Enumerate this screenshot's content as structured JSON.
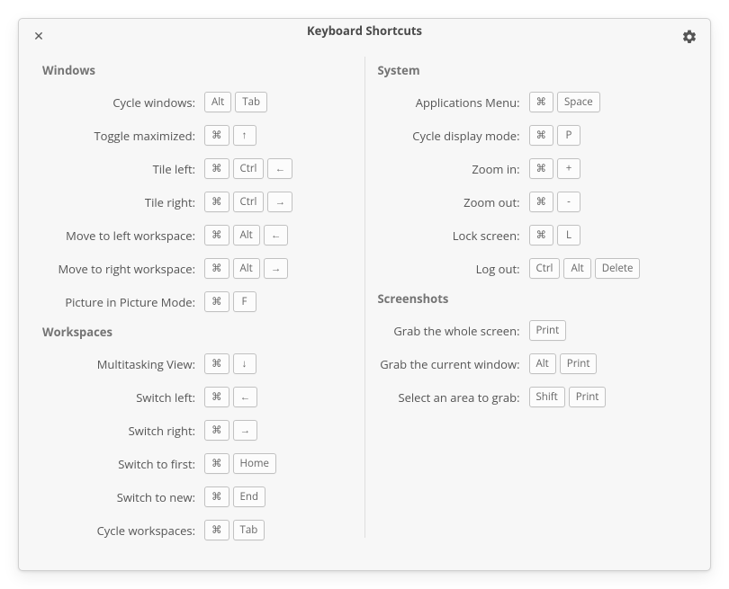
{
  "title": "Keyboard Shortcuts",
  "left": {
    "windows": {
      "heading": "Windows",
      "rows": [
        {
          "label": "Cycle windows:",
          "keys": [
            "Alt",
            "Tab"
          ]
        },
        {
          "label": "Toggle maximized:",
          "keys": [
            "⌘",
            "↑"
          ]
        },
        {
          "label": "Tile left:",
          "keys": [
            "⌘",
            "Ctrl",
            "←"
          ]
        },
        {
          "label": "Tile right:",
          "keys": [
            "⌘",
            "Ctrl",
            "→"
          ]
        },
        {
          "label": "Move to left workspace:",
          "keys": [
            "⌘",
            "Alt",
            "←"
          ]
        },
        {
          "label": "Move to right workspace:",
          "keys": [
            "⌘",
            "Alt",
            "→"
          ]
        },
        {
          "label": "Picture in Picture Mode:",
          "keys": [
            "⌘",
            "F"
          ]
        }
      ]
    },
    "workspaces": {
      "heading": "Workspaces",
      "rows": [
        {
          "label": "Multitasking View:",
          "keys": [
            "⌘",
            "↓"
          ]
        },
        {
          "label": "Switch left:",
          "keys": [
            "⌘",
            "←"
          ]
        },
        {
          "label": "Switch right:",
          "keys": [
            "⌘",
            "→"
          ]
        },
        {
          "label": "Switch to first:",
          "keys": [
            "⌘",
            "Home"
          ]
        },
        {
          "label": "Switch to new:",
          "keys": [
            "⌘",
            "End"
          ]
        },
        {
          "label": "Cycle workspaces:",
          "keys": [
            "⌘",
            "Tab"
          ]
        }
      ]
    }
  },
  "right": {
    "system": {
      "heading": "System",
      "rows": [
        {
          "label": "Applications Menu:",
          "keys": [
            "⌘",
            "Space"
          ]
        },
        {
          "label": "Cycle display mode:",
          "keys": [
            "⌘",
            "P"
          ]
        },
        {
          "label": "Zoom in:",
          "keys": [
            "⌘",
            "+"
          ]
        },
        {
          "label": "Zoom out:",
          "keys": [
            "⌘",
            "-"
          ]
        },
        {
          "label": "Lock screen:",
          "keys": [
            "⌘",
            "L"
          ]
        },
        {
          "label": "Log out:",
          "keys": [
            "Ctrl",
            "Alt",
            "Delete"
          ]
        }
      ]
    },
    "screenshots": {
      "heading": "Screenshots",
      "rows": [
        {
          "label": "Grab the whole screen:",
          "keys": [
            "Print"
          ]
        },
        {
          "label": "Grab the current window:",
          "keys": [
            "Alt",
            "Print"
          ]
        },
        {
          "label": "Select an area to grab:",
          "keys": [
            "Shift",
            "Print"
          ]
        }
      ]
    }
  }
}
